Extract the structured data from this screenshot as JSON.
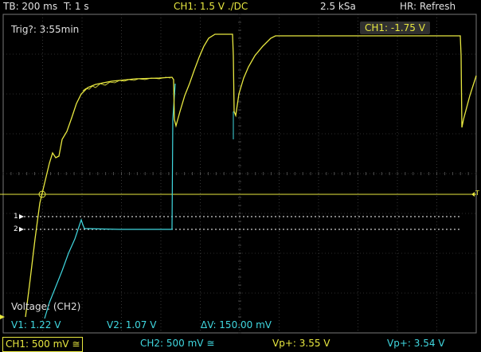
{
  "header": {
    "timebase": "TB: 200 ms",
    "trigger_time": "T: 1 s",
    "channel_setting": "CH1: 1.5 V ./DC",
    "sample_rate": "2.5 kSa",
    "mode": "HR: Refresh"
  },
  "overlays": {
    "trigger_info": "Trig?: 3:55min",
    "ch1_offset": "CH1: -1.75 V",
    "cursor_source": "Voltage: (CH2)",
    "v1": "V1: 1.22 V",
    "v2": "V2: 1.07 V",
    "delta_v": "ΔV: 150.00 mV",
    "marker_1": "1",
    "marker_2": "2",
    "trigger_marker": "T"
  },
  "footer": {
    "ch1_scale": "CH1: 500 mV ≅",
    "ch2_scale": "CH2: 500 mV ≅",
    "meas1": "Vp+: 3.55 V",
    "meas2": "Vp+: 3.54 V"
  },
  "colors": {
    "ch1": "#e8e840",
    "ch2": "#40d8e0",
    "grid": "#5a5a5a",
    "background": "#000000",
    "text": "#e0e0e0"
  }
}
